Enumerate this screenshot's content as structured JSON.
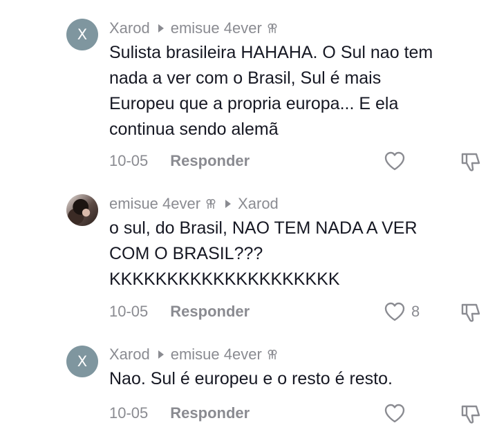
{
  "comments": [
    {
      "avatar_letter": "X",
      "author": "Xarod",
      "reply_to": "emisue 4ever",
      "reply_to_badge_icon": "friends-icon",
      "author_badge_icon": "",
      "text": "Sulista brasileira HAHAHA. O Sul nao tem\nnada a ver com o Brasil, Sul é mais\nEuropeu que a propria europa... E ela\ncontinua sendo alemã",
      "date": "10-05",
      "reply_label": "Responder",
      "like_count": ""
    },
    {
      "avatar_letter": "",
      "author": "emisue 4ever",
      "reply_to": "Xarod",
      "author_badge_icon": "friends-icon",
      "text": "o sul, do Brasil, NAO TEM NADA A VER\nCOM O BRASIL???\nKKKKKKKKKKKKKKKKKKKK",
      "date": "10-05",
      "reply_label": "Responder",
      "like_count": "8"
    },
    {
      "avatar_letter": "X",
      "author": "Xarod",
      "reply_to": "emisue 4ever",
      "reply_to_badge_icon": "friends-icon",
      "text": "Nao. Sul é europeu e o resto é resto.",
      "date": "10-05",
      "reply_label": "Responder",
      "like_count": ""
    }
  ],
  "colors": {
    "avatar_bg": "#7f969f",
    "meta_gray": "#8a8b91",
    "text": "#161823"
  }
}
